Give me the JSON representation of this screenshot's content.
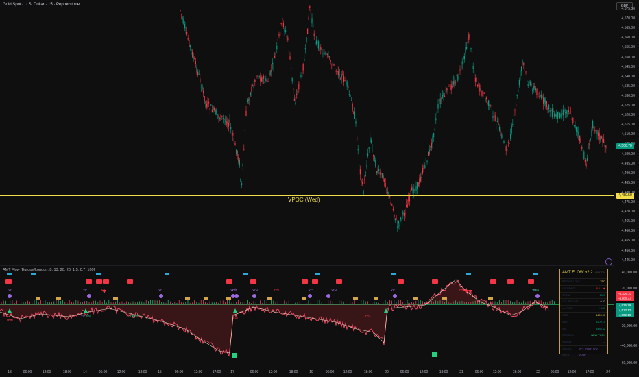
{
  "chart": {
    "title": "Gold Spot / U.S. Dollar · 15 · Pepperstone",
    "currency": "GBP",
    "price_axis": [
      "4,575.00",
      "4,570.00",
      "4,565.00",
      "4,560.00",
      "4,555.00",
      "4,550.00",
      "4,545.00",
      "4,540.00",
      "4,535.00",
      "4,530.00",
      "4,525.00",
      "4,520.00",
      "4,515.00",
      "4,510.00",
      "4,505.00",
      "4,500.00",
      "4,495.00",
      "4,490.00",
      "4,485.00",
      "4,480.00",
      "4,475.00",
      "4,470.00",
      "4,465.00",
      "4,460.00",
      "4,455.00",
      "4,450.00",
      "4,445.00"
    ],
    "current_price": "4,506.70",
    "vpoc_price": "4,480.50",
    "vpoc_label": "VPOC (Wed)",
    "colors": {
      "up": "#089981",
      "down": "#f23645",
      "vpoc": "#f2de4a",
      "bg": "#0f0f0f",
      "flow_up": "#26d07c",
      "flow_down": "#ff4d6d"
    }
  },
  "indicator": {
    "title": "AMT Flow [Europe/London, 8, 13, 20, 20, 1.5, 0.7, 100]",
    "axis": [
      "40,000.00",
      "20,000.00",
      "-20,000.00",
      "-40,000.00",
      "-60,000.00"
    ],
    "tags": [
      {
        "text": "-6,336.10",
        "color": "#f23645"
      },
      {
        "text": "-6,078.44",
        "color": "#f23645"
      },
      {
        "text": "4,926.79",
        "color": "#089981"
      },
      {
        "text": "4,512.12",
        "color": "#089981"
      },
      {
        "text": "4,002.18",
        "color": "#089981"
      }
    ],
    "markers": [
      "VP",
      "VP",
      "FAI",
      "VP",
      "VP",
      "VP/x",
      "VP2",
      "FAI",
      "VP",
      "VP2",
      "VP",
      "VP",
      "VP",
      "FAI",
      "FAI",
      "FB(6)",
      "FB(6)",
      "FAI",
      "FAI",
      "FAI",
      "FAI",
      "FAI",
      "FB1"
    ]
  },
  "amt_panel": {
    "title": "AMT FLOW v2.2",
    "version": "LONDON",
    "rows": [
      {
        "k": "REGIME / DAY",
        "v": "TRD"
      },
      {
        "k": "CVD/SWG",
        "v": "BULL ▼"
      },
      {
        "k": "SVD Δ",
        "v": "+1307"
      },
      {
        "k": "VOL REGIME",
        "v": "0.52"
      },
      {
        "k": "vs VWAP",
        "v": "+4.41"
      },
      {
        "k": "POC",
        "v": "4499.07"
      },
      {
        "k": "VAH",
        "v": "4509.15"
      },
      {
        "k": "VAL",
        "v": "4486.42"
      },
      {
        "k": "SESSION",
        "v": "NEW YORK"
      },
      {
        "k": "SIGNAL",
        "v": "—"
      },
      {
        "k": "CROSS AREA",
        "v": "VP1 VWAP VP2 VDAP"
      }
    ]
  },
  "time_axis": [
    "13",
    "06:00",
    "12:00",
    "18:00",
    "14",
    "06:00",
    "12:00",
    "18:00",
    "15",
    "06:00",
    "12:00",
    "17:00",
    "17",
    "06:00",
    "12:00",
    "18:00",
    "19",
    "06:00",
    "12:00",
    "18:00",
    "20",
    "06:00",
    "12:00",
    "18:00",
    "21",
    "06:00",
    "12:00",
    "18:00",
    "22",
    "06:00",
    "12:00",
    "17:00",
    "24"
  ]
}
